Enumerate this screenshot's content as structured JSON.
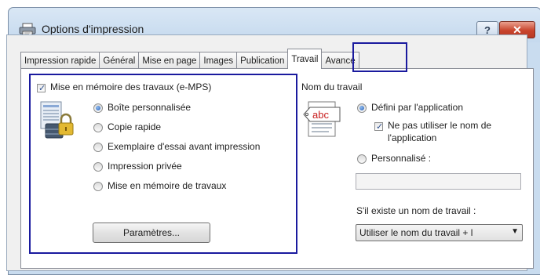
{
  "window": {
    "title": "Options d'impression",
    "help_label": "?",
    "close_label": "✕"
  },
  "tabs": [
    {
      "label": "Impression rapide"
    },
    {
      "label": "Général"
    },
    {
      "label": "Mise en page"
    },
    {
      "label": "Images"
    },
    {
      "label": "Publication"
    },
    {
      "label": "Travail",
      "active": true
    },
    {
      "label": "Avancé"
    }
  ],
  "job_storage": {
    "checkbox_label": "Mise en mémoire des travaux (e-MPS)",
    "checked": true,
    "options": [
      {
        "label": "Boîte personnalisée",
        "selected": true
      },
      {
        "label": "Copie rapide",
        "selected": false
      },
      {
        "label": "Exemplaire d'essai avant impression",
        "selected": false
      },
      {
        "label": "Impression privée",
        "selected": false
      },
      {
        "label": "Mise en mémoire de travaux",
        "selected": false
      }
    ],
    "settings_button": "Paramètres..."
  },
  "job_name": {
    "heading": "Nom du travail",
    "icon_text": "abc",
    "option_app_label": "Défini par l'application",
    "option_app_selected": true,
    "dont_use_app_name_line1": "Ne pas utiliser le nom de",
    "dont_use_app_name_line2": "l'application",
    "dont_use_app_name_checked": true,
    "option_custom_label": "Personnalisé :",
    "option_custom_selected": false,
    "custom_value": "",
    "exists_label": "S'il existe un nom de travail :",
    "exists_select_value": "Utiliser le nom du travail + l"
  }
}
